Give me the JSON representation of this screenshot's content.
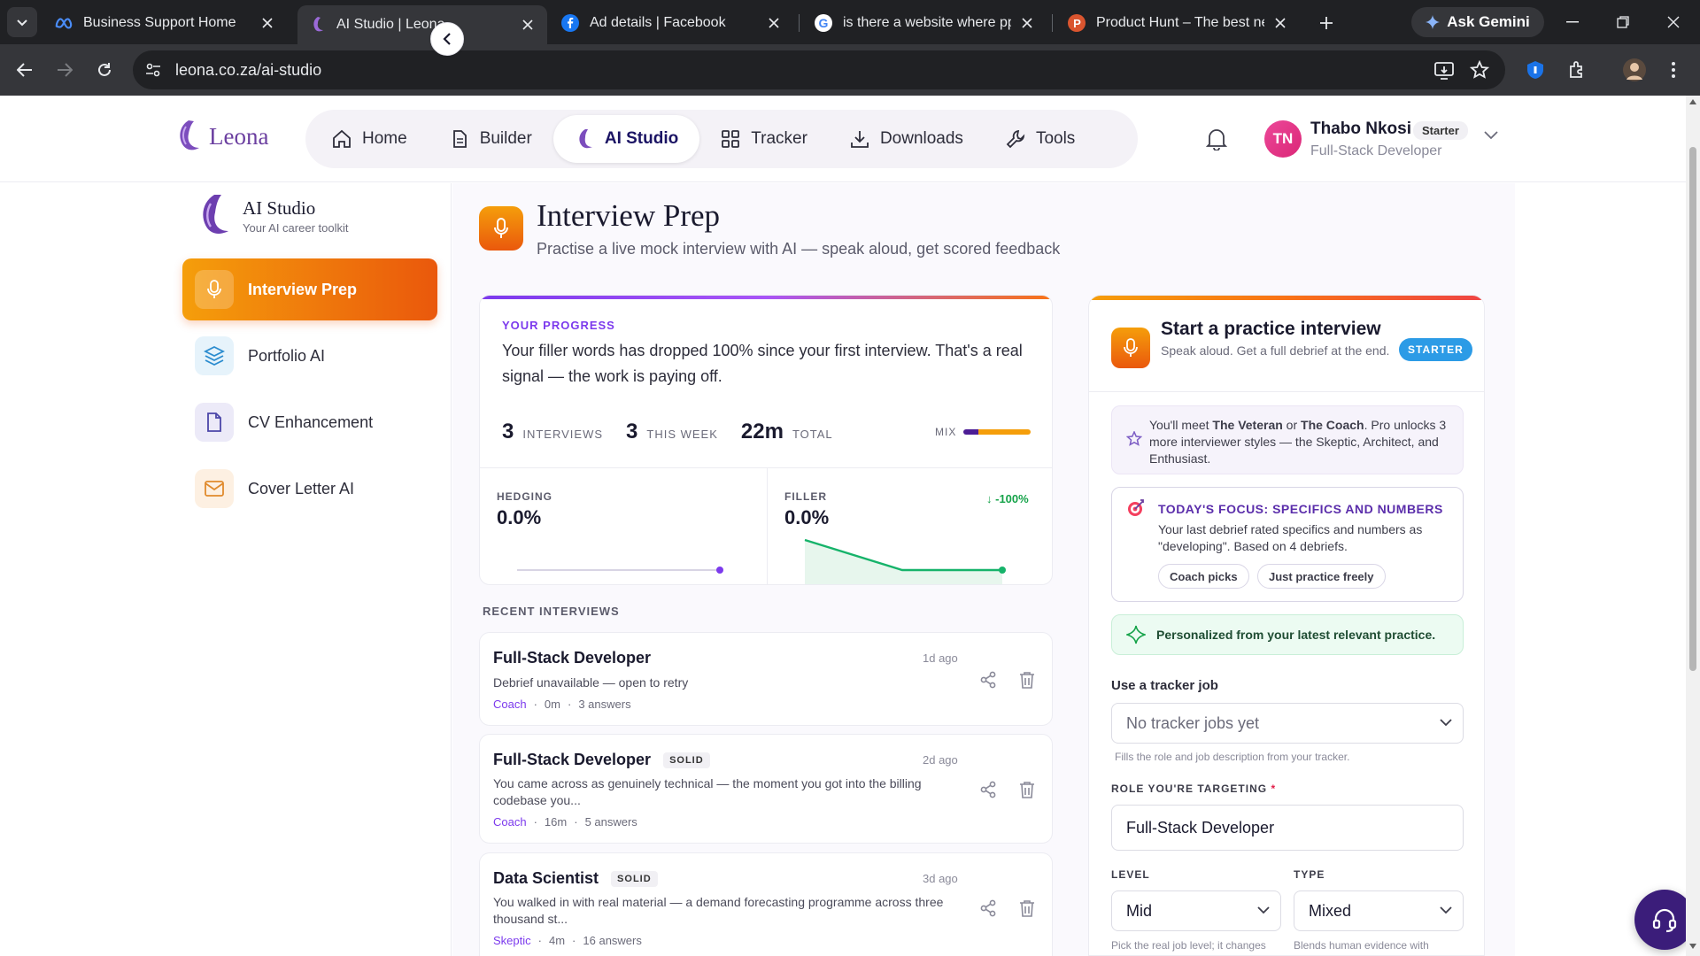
{
  "browser": {
    "tabs": [
      {
        "title": "Business Support Home",
        "active": false
      },
      {
        "title": "AI Studio | Leona",
        "active": true
      },
      {
        "title": "Ad details | Facebook",
        "active": false
      },
      {
        "title": "is there a website where ppl g",
        "active": false
      },
      {
        "title": "Product Hunt – The best new",
        "active": false
      }
    ],
    "gemini_label": "Ask Gemini",
    "url": "leona.co.za/ai-studio"
  },
  "header": {
    "logo_text": "Leona",
    "nav": [
      {
        "label": "Home",
        "icon": "home-icon",
        "active": false
      },
      {
        "label": "Builder",
        "icon": "document-icon",
        "active": false
      },
      {
        "label": "AI Studio",
        "icon": "leona-icon",
        "active": true
      },
      {
        "label": "Tracker",
        "icon": "grid-icon",
        "active": false
      },
      {
        "label": "Downloads",
        "icon": "download-icon",
        "active": false
      },
      {
        "label": "Tools",
        "icon": "wrench-icon",
        "active": false
      }
    ],
    "user": {
      "initials": "TN",
      "name": "Thabo Nkosi",
      "plan": "Starter",
      "role": "Full-Stack Developer"
    }
  },
  "sidebar": {
    "title": "AI Studio",
    "subtitle": "Your AI career toolkit",
    "items": [
      {
        "label": "Interview Prep",
        "icon": "microphone-icon",
        "active": true
      },
      {
        "label": "Portfolio AI",
        "icon": "layers-icon",
        "active": false
      },
      {
        "label": "CV Enhancement",
        "icon": "file-icon",
        "active": false
      },
      {
        "label": "Cover Letter AI",
        "icon": "mail-icon",
        "active": false
      }
    ]
  },
  "page": {
    "title": "Interview Prep",
    "subtitle": "Practise a live mock interview with AI — speak aloud, get scored feedback"
  },
  "progress": {
    "label": "YOUR PROGRESS",
    "message": "Your filler words has dropped 100% since your first interview. That's a real signal — the work is paying off.",
    "stats": [
      {
        "value": "3",
        "unit": "INTERVIEWS"
      },
      {
        "value": "3",
        "unit": "THIS WEEK"
      },
      {
        "value": "22m",
        "unit": "TOTAL"
      }
    ],
    "mix_label": "MIX",
    "hedging": {
      "label": "HEDGING",
      "value": "0.0%"
    },
    "filler": {
      "label": "FILLER",
      "value": "0.0%",
      "delta": "-100%"
    }
  },
  "recent": {
    "label": "RECENT INTERVIEWS",
    "items": [
      {
        "role": "Full-Stack Developer",
        "badge": "",
        "ago": "1d ago",
        "desc": "Debrief unavailable — open to retry",
        "coach": "Coach",
        "duration": "0m",
        "answers": "3 answers"
      },
      {
        "role": "Full-Stack Developer",
        "badge": "SOLID",
        "ago": "2d ago",
        "desc": "You came across as genuinely technical — the moment you got into the billing codebase you...",
        "coach": "Coach",
        "duration": "16m",
        "answers": "5 answers"
      },
      {
        "role": "Data Scientist",
        "badge": "SOLID",
        "ago": "3d ago",
        "desc": "You walked in with real material — a demand forecasting programme across three thousand st...",
        "coach": "Skeptic",
        "duration": "4m",
        "answers": "16 answers"
      }
    ]
  },
  "start": {
    "title": "Start a practice interview",
    "subtitle": "Speak aloud. Get a full debrief at the end.",
    "badge": "STARTER",
    "meet_a": "You'll meet ",
    "meet_b1": "The Veteran",
    "meet_or": " or ",
    "meet_b2": "The Coach",
    "meet_c": ". Pro unlocks 3 more interviewer styles — the Skeptic, Architect, and Enthusiast.",
    "focus_title": "TODAY'S FOCUS: SPECIFICS AND NUMBERS",
    "focus_body": "Your last debrief rated specifics and numbers as \"developing\". Based on 4 debriefs.",
    "chip_a": "Coach picks",
    "chip_b": "Just practice freely",
    "personalized": "Personalized from your latest relevant practice.",
    "tracker_label": "Use a tracker job",
    "tracker_value": "No tracker jobs yet",
    "tracker_hint": "Fills the role and job description from your tracker.",
    "role_label": "ROLE YOU'RE TARGETING",
    "role_required": "*",
    "role_value": "Full-Stack Developer",
    "level_label": "LEVEL",
    "level_value": "Mid",
    "level_hint": "Pick the real job level; it changes",
    "type_label": "TYPE",
    "type_value": "Mixed",
    "type_hint": "Blends human evidence with"
  },
  "colors": {
    "accent_orange": "#ea580c",
    "accent_purple": "#7c3aed",
    "starter_badge": "#2c9be6",
    "success_green": "#16a34a"
  }
}
